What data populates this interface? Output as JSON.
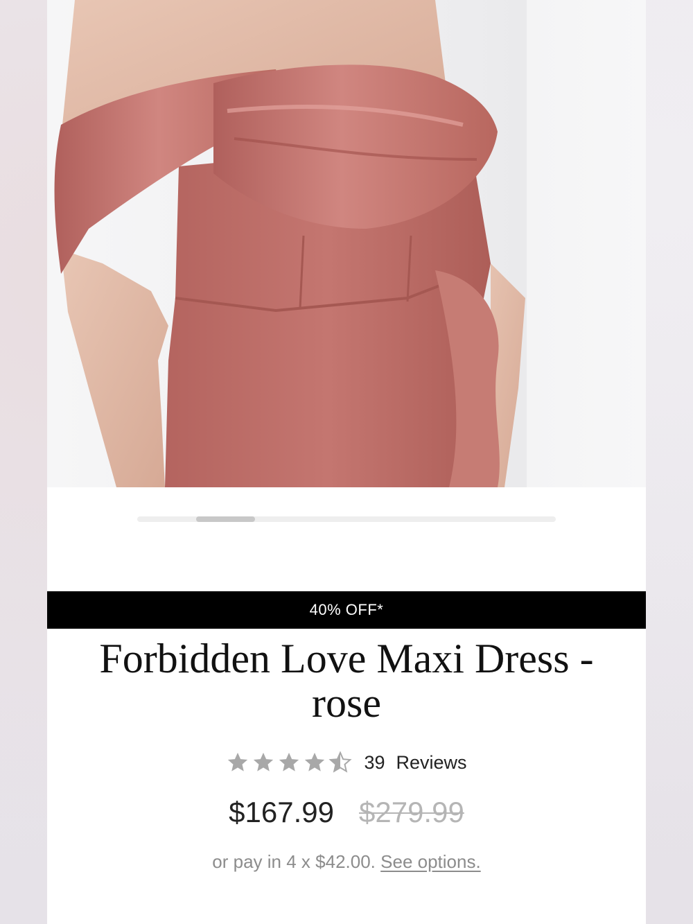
{
  "product_image": {
    "alt": ""
  },
  "carousel": {
    "position": 0.14,
    "visible_fraction": 0.14
  },
  "promo": {
    "label": "40% OFF*"
  },
  "product": {
    "title": "Forbidden Love Maxi Dress - rose",
    "rating": {
      "value": 4.5,
      "max": 5,
      "count": "39",
      "reviews_label": "Reviews"
    },
    "price": {
      "current": "$167.99",
      "original": "$279.99"
    },
    "installments": {
      "text": "or pay in 4 x $42.00.",
      "link_label": "See options."
    }
  },
  "colors": {
    "dress": "#c0716c",
    "promo_bg": "#000000",
    "star": "#a8a8a8"
  }
}
